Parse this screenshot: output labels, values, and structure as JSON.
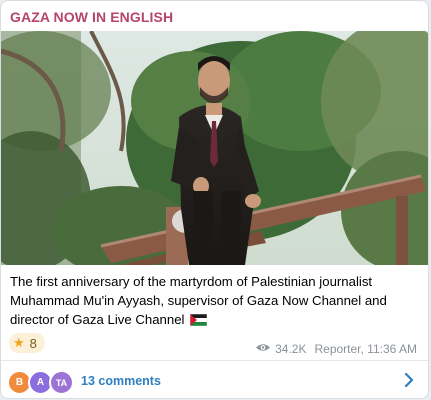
{
  "channel": {
    "name": "GAZA NOW IN ENGLISH",
    "name_color": "#b5446e"
  },
  "post": {
    "caption": "The first anniversary of the martyrdom of Palestinian journalist Muhammad Mu'in Ayyash, supervisor of Gaza Now Channel and director of Gaza Live Channel",
    "flag_icon": "palestine-flag-icon"
  },
  "reactions": [
    {
      "icon": "star-icon",
      "count": "8"
    }
  ],
  "meta": {
    "views": "34.2K",
    "author_time": "Reporter, 11:36 AM",
    "views_icon": "eye-icon"
  },
  "comments": {
    "avatars": [
      {
        "initial": "B",
        "color": "#f08a3c"
      },
      {
        "initial": "A",
        "color": "#8a6ee0"
      },
      {
        "initial": "TA",
        "color": "#9b74d6"
      }
    ],
    "label": "13 comments",
    "accent": "#2f7fc1"
  }
}
